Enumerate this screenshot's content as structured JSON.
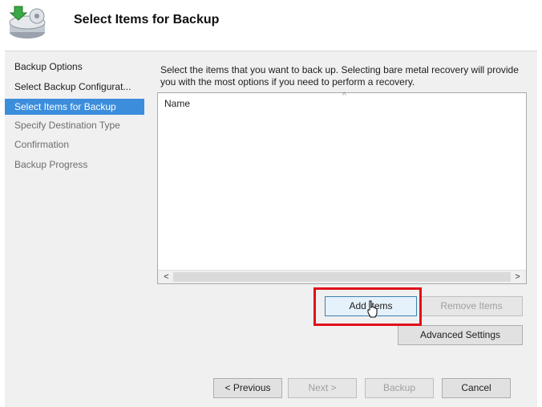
{
  "header": {
    "title": "Select Items for Backup",
    "icon": "backup-wizard-icon"
  },
  "sidebar": {
    "items": [
      {
        "label": "Backup Options",
        "state": "normal"
      },
      {
        "label": "Select Backup Configurat...",
        "state": "normal"
      },
      {
        "label": "Select Items for Backup",
        "state": "active"
      },
      {
        "label": "Specify Destination Type",
        "state": "disabled"
      },
      {
        "label": "Confirmation",
        "state": "disabled"
      },
      {
        "label": "Backup Progress",
        "state": "disabled"
      }
    ]
  },
  "main": {
    "description": "Select the items that you want to back up. Selecting bare metal recovery will provide you with the most options if you need to perform a recovery.",
    "list": {
      "column_header": "Name",
      "sort_glyph": "^",
      "scroll_left": "<",
      "scroll_right": ">"
    },
    "buttons": {
      "add_items": "Add Items",
      "remove_items": "Remove Items",
      "advanced_settings": "Advanced Settings"
    }
  },
  "footer": {
    "previous": "< Previous",
    "next": "Next >",
    "backup": "Backup",
    "cancel": "Cancel"
  },
  "colors": {
    "selection": "#3c8ddc",
    "highlight": "#e0101a",
    "panel": "#f0f0f0"
  }
}
